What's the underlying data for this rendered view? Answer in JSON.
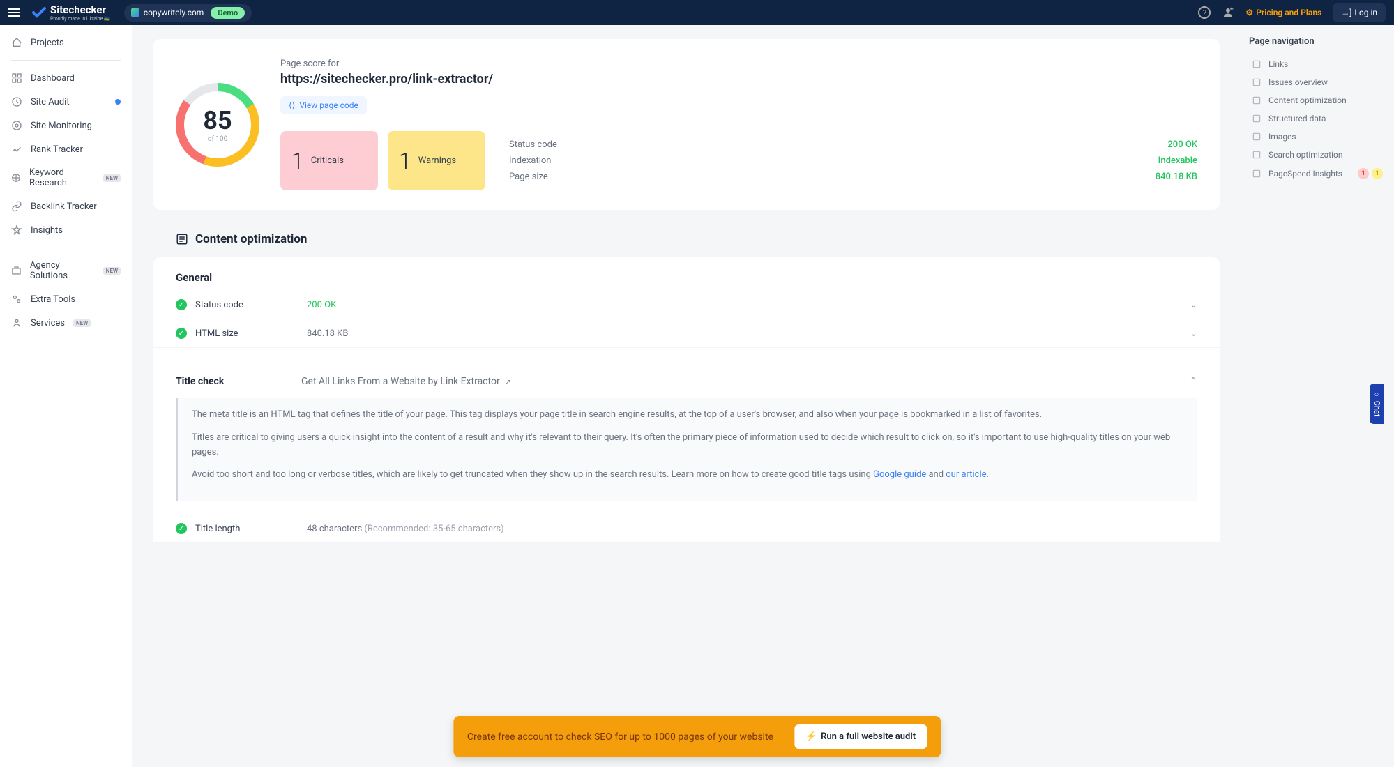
{
  "header": {
    "brand": "Sitechecker",
    "tagline": "Proudly made in Ukraine 🇺🇦",
    "domain": "copywritely.com",
    "demo": "Demo",
    "pricing": "Pricing and Plans",
    "login": "Log in"
  },
  "sidebar": {
    "projects": "Projects",
    "items": [
      {
        "label": "Dashboard",
        "icon": "dashboard"
      },
      {
        "label": "Site Audit",
        "icon": "audit",
        "dot": true
      },
      {
        "label": "Site Monitoring",
        "icon": "monitor"
      },
      {
        "label": "Rank Tracker",
        "icon": "rank"
      },
      {
        "label": "Keyword Research",
        "icon": "keyword",
        "new": true
      },
      {
        "label": "Backlink Tracker",
        "icon": "backlink"
      },
      {
        "label": "Insights",
        "icon": "insights"
      }
    ],
    "items2": [
      {
        "label": "Agency Solutions",
        "icon": "agency",
        "new": true
      },
      {
        "label": "Extra Tools",
        "icon": "tools"
      },
      {
        "label": "Services",
        "icon": "services",
        "new": true
      }
    ],
    "new_label": "NEW"
  },
  "score": {
    "value": "85",
    "of": "of 100",
    "label": "Page score for",
    "url": "https://sitechecker.pro/link-extractor/",
    "view_code": "View page code"
  },
  "metrics": {
    "criticals": {
      "n": "1",
      "label": "Criticals"
    },
    "warnings": {
      "n": "1",
      "label": "Warnings"
    },
    "rows": [
      {
        "k": "Status code",
        "v": "200 OK"
      },
      {
        "k": "Indexation",
        "v": "Indexable"
      },
      {
        "k": "Page size",
        "v": "840.18 KB"
      }
    ]
  },
  "content": {
    "title": "Content optimization",
    "general": "General",
    "rows": [
      {
        "label": "Status code",
        "val": "200 OK",
        "ok": true
      },
      {
        "label": "HTML size",
        "val": "840.18 KB"
      }
    ],
    "title_check": {
      "label": "Title check",
      "val": "Get All Links From a Website by Link Extractor",
      "p1": "The meta title is an HTML tag that defines the title of your page. This tag displays your page title in search engine results, at the top of a user's browser, and also when your page is bookmarked in a list of favorites.",
      "p2": "Titles are critical to giving users a quick insight into the content of a result and why it's relevant to their query. It's often the primary piece of information used to decide which result to click on, so it's important to use high-quality titles on your web pages.",
      "p3a": "Avoid too short and too long or verbose titles, which are likely to get truncated when they show up in the search results. Learn more on how to create good title tags using ",
      "link1": "Google guide",
      "and": " and ",
      "link2": "our article",
      "length_label": "Title length",
      "length_val": "48 characters ",
      "length_rec": "(Recommended: 35-65 characters)"
    }
  },
  "rightbar": {
    "title": "Page navigation",
    "items": [
      {
        "label": "Links"
      },
      {
        "label": "Issues overview"
      },
      {
        "label": "Content optimization"
      },
      {
        "label": "Structured data"
      },
      {
        "label": "Images"
      },
      {
        "label": "Search optimization"
      },
      {
        "label": "PageSpeed Insights",
        "badges": [
          "1",
          "1"
        ]
      }
    ]
  },
  "banner": {
    "text": "Create free account to check SEO for up to 1000 pages of your website",
    "btn": "Run a full website audit"
  },
  "chat": "Chat"
}
